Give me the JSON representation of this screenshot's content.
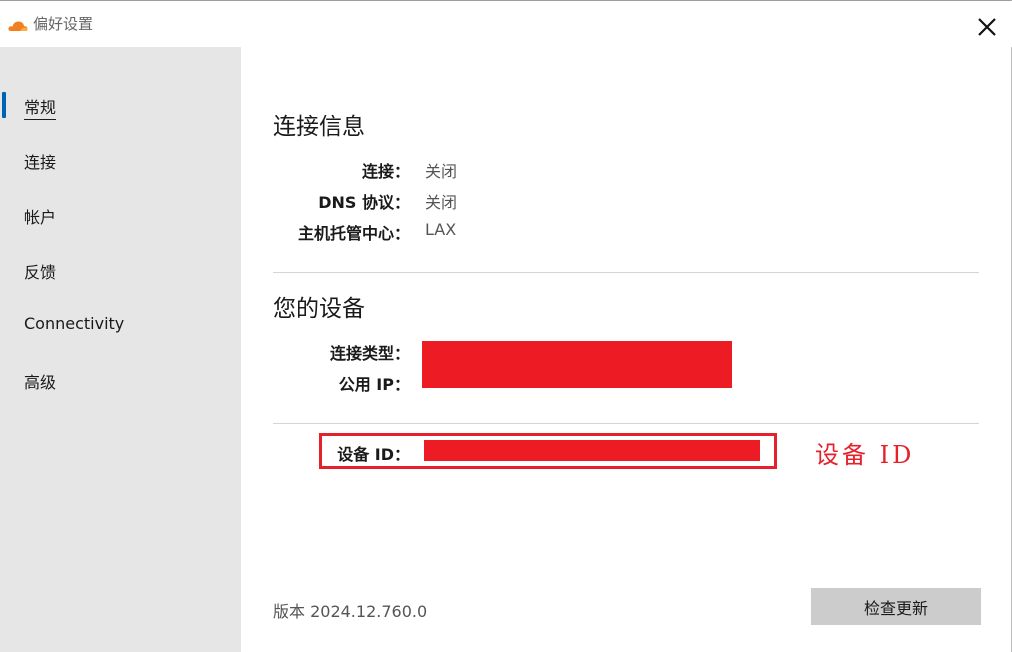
{
  "window": {
    "title": "偏好设置",
    "logo_icon": "cloudflare-cloud-icon",
    "close_icon": "close-icon",
    "brand_color": "#f38020",
    "accent_color": "#0063b1"
  },
  "sidebar": {
    "items": [
      {
        "label": "常规",
        "active": true
      },
      {
        "label": "连接",
        "active": false
      },
      {
        "label": "帐户",
        "active": false
      },
      {
        "label": "反馈",
        "active": false
      },
      {
        "label": "Connectivity",
        "active": false
      },
      {
        "label": "高级",
        "active": false
      }
    ]
  },
  "connection_info": {
    "title": "连接信息",
    "rows": [
      {
        "label": "连接：",
        "value": "关闭"
      },
      {
        "label": "DNS 协议：",
        "value": "关闭"
      },
      {
        "label": "主机托管中心：",
        "value": "LAX"
      }
    ]
  },
  "device": {
    "title": "您的设备",
    "connection_type_label": "连接类型：",
    "public_ip_label": "公用 IP：",
    "device_id_label": "设备 ID：",
    "redaction_color": "#ed1c24"
  },
  "annotation": {
    "text": "设备  ID",
    "color": "#e5212b"
  },
  "footer": {
    "version_text": "版本  2024.12.760.0",
    "check_update_label": "检查更新"
  }
}
